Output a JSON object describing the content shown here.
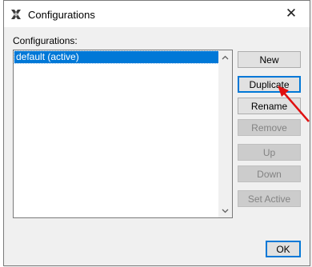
{
  "window": {
    "title": "Configurations",
    "close_symbol": "✕"
  },
  "configurations": {
    "label": "Configurations:",
    "items": [
      "default (active)"
    ],
    "selected_index": 0
  },
  "buttons": {
    "new": "New",
    "duplicate": "Duplicate",
    "rename": "Rename",
    "remove": "Remove",
    "up": "Up",
    "down": "Down",
    "set_active": "Set Active",
    "ok": "OK"
  },
  "icons": {
    "app": "netbeans-logo-icon",
    "close": "close-icon",
    "scroll_up": "chevron-up-icon",
    "scroll_down": "chevron-down-icon",
    "annotation": "red-arrow-icon"
  },
  "colors": {
    "selection": "#0078d7",
    "annotation_arrow": "#e01010"
  }
}
